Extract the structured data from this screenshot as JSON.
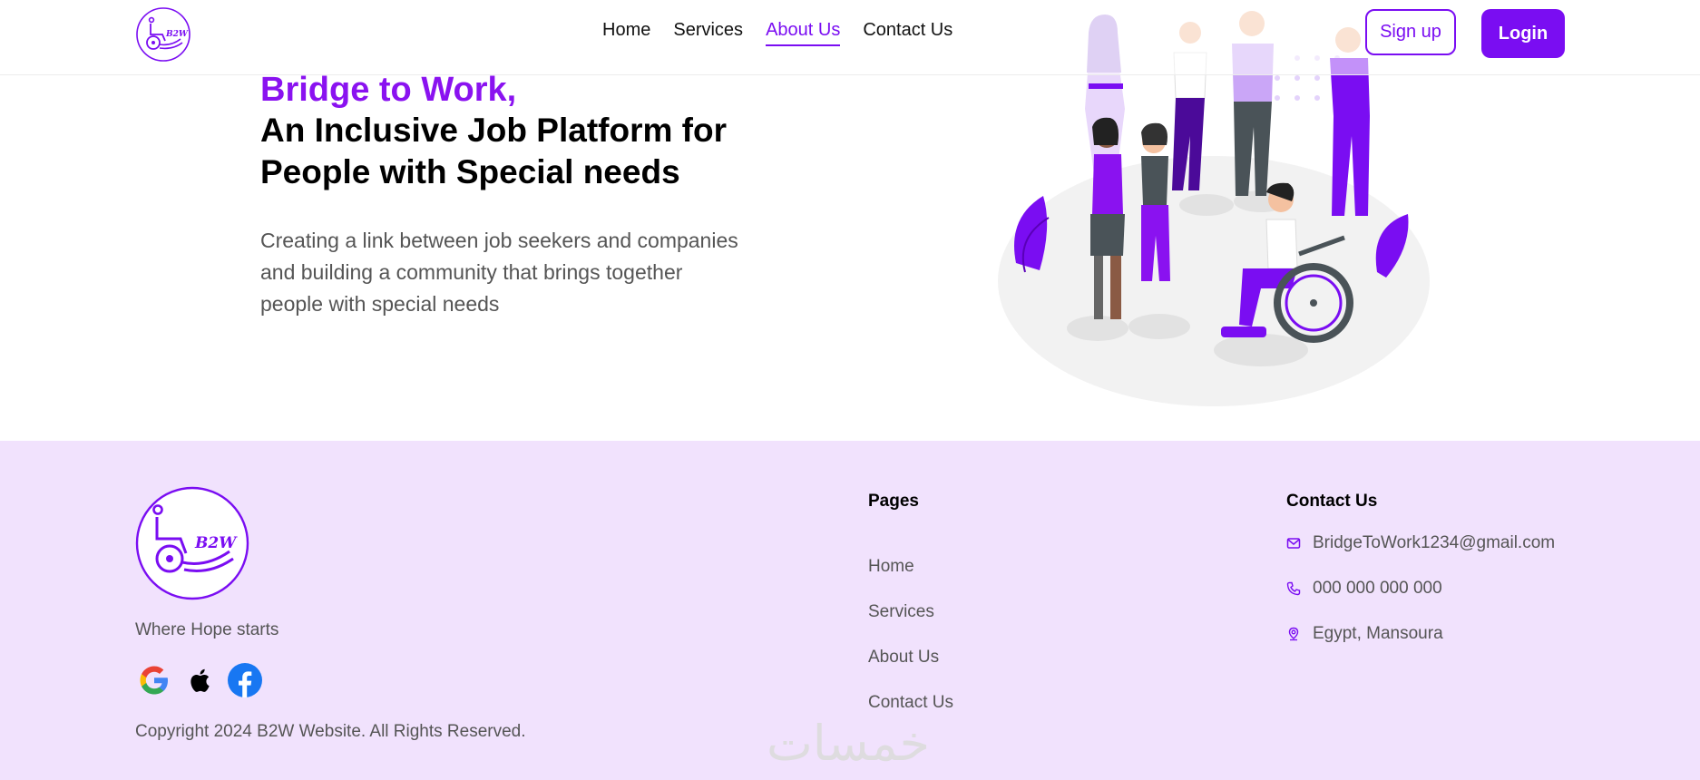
{
  "header": {
    "logo_text": "B2W",
    "nav": [
      {
        "label": "Home",
        "active": false
      },
      {
        "label": "Services",
        "active": false
      },
      {
        "label": "About Us",
        "active": true
      },
      {
        "label": "Contact Us",
        "active": false
      }
    ],
    "signup_label": "Sign up",
    "login_label": "Login"
  },
  "hero": {
    "brand": "Bridge to Work,",
    "title_line1": "An Inclusive Job Platform for",
    "title_line2": "People with Special needs",
    "description": "Creating a link between job seekers and companies and building a community that brings together people with special needs"
  },
  "footer": {
    "logo_text": "B2W",
    "tagline": "Where Hope starts",
    "social_icons": [
      "google-icon",
      "apple-icon",
      "facebook-icon"
    ],
    "copyright": "Copyright 2024 B2W Website. All Rights Reserved.",
    "pages_title": "Pages",
    "pages": [
      "Home",
      "Services",
      "About Us",
      "Contact Us"
    ],
    "contact_title": "Contact Us",
    "contact": {
      "email": "BridgeToWork1234@gmail.com",
      "phone": "000 000 000 000",
      "address": "Egypt, Mansoura"
    },
    "watermark": "خمسات"
  },
  "colors": {
    "accent": "#7a0df2",
    "footer_bg": "#f1e2fd",
    "text_muted": "#555555"
  }
}
